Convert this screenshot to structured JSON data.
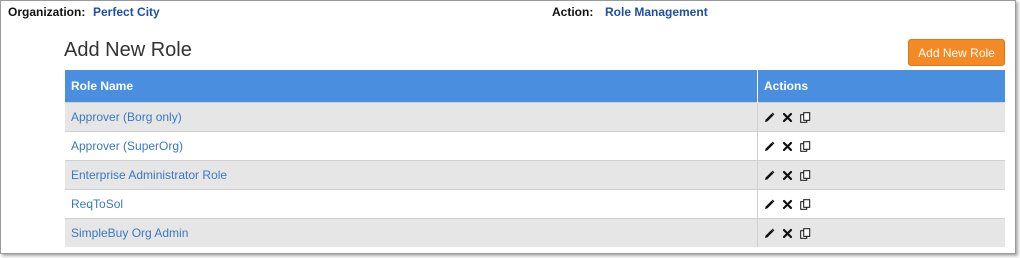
{
  "header": {
    "organization_label": "Organization:",
    "organization_value": "Perfect City",
    "action_label": "Action:",
    "action_value": "Role Management"
  },
  "page": {
    "title": "Add New Role",
    "add_button_label": "Add New Role"
  },
  "table": {
    "columns": [
      "Role Name",
      "Actions"
    ],
    "rows": [
      {
        "name": "Approver (Borg only)"
      },
      {
        "name": "Approver (SuperOrg)"
      },
      {
        "name": "Enterprise Administrator Role"
      },
      {
        "name": "ReqToSol"
      },
      {
        "name": "SimpleBuy Org Admin"
      }
    ],
    "row_action_icons": [
      "pencil-edit-icon",
      "delete-x-icon",
      "copy-icon"
    ]
  },
  "colors": {
    "header_bg": "#4a8ee0",
    "add_button_bg": "#f48a25",
    "link": "#3a78c2",
    "context_value": "#1f4fa3"
  }
}
